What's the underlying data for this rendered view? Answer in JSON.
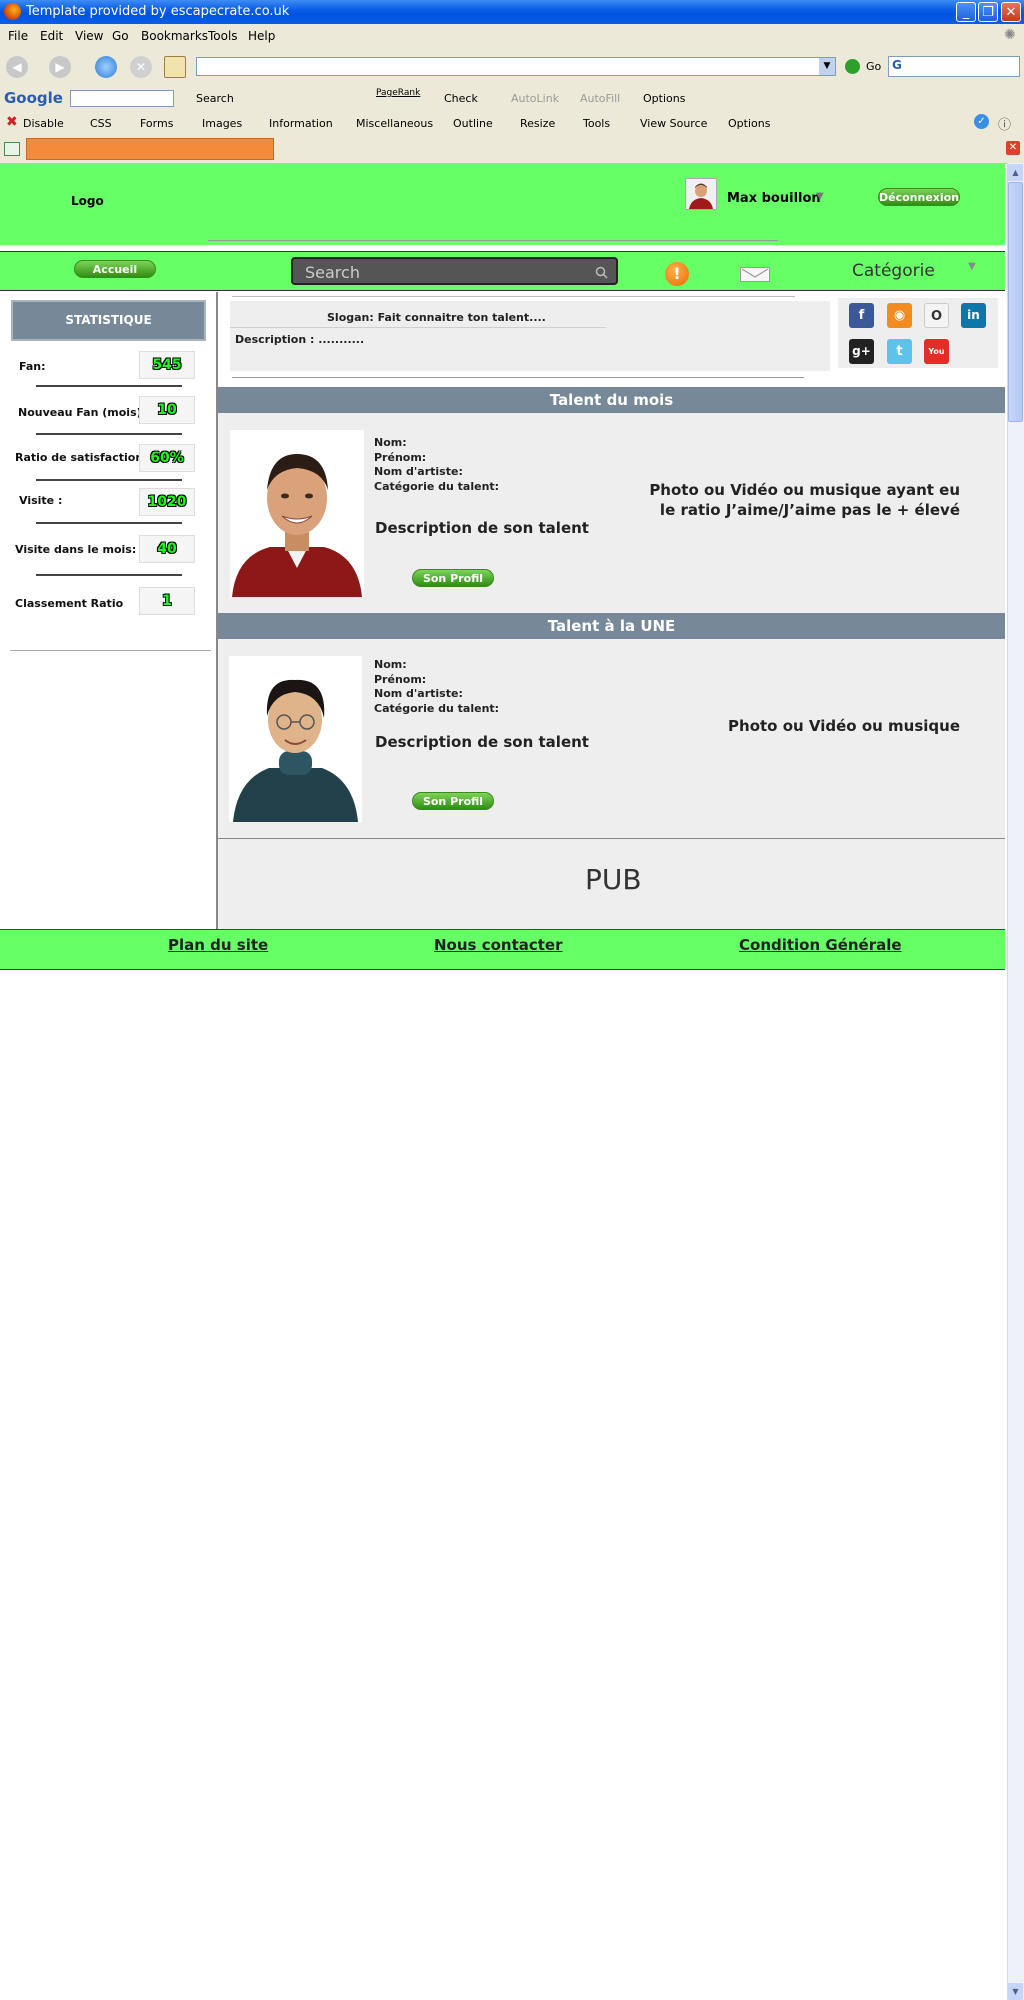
{
  "browser": {
    "title": "Template provided by escapecrate.co.uk",
    "menu": [
      "File",
      "Edit",
      "View",
      "Go",
      "Bookmarks",
      "Tools",
      "Help"
    ],
    "go_label": "Go",
    "google_toolbar": {
      "logo": "Google",
      "search": "Search",
      "pagerank": "PageRank",
      "check": "Check",
      "autolink": "AutoLink",
      "autofill": "AutoFill",
      "options": "Options"
    },
    "webdev_toolbar": [
      "Disable",
      "CSS",
      "Forms",
      "Images",
      "Information",
      "Miscellaneous",
      "Outline",
      "Resize",
      "Tools",
      "View Source",
      "Options"
    ]
  },
  "header": {
    "logo": "Logo",
    "user_name": "Max bouillon",
    "logout_label": "Déconnexion"
  },
  "nav": {
    "home_label": "Accueil",
    "search_placeholder": "Search",
    "category_label": "Catégorie"
  },
  "stats": {
    "title": "STATISTIQUE",
    "items": [
      {
        "label": "Fan:",
        "value": "545"
      },
      {
        "label": "Nouveau Fan (mois):",
        "value": "10"
      },
      {
        "label": "Ratio de satisfaction:",
        "value": "60%"
      },
      {
        "label": "Visite :",
        "value": "1020"
      },
      {
        "label": "Visite dans le mois:",
        "value": "40"
      },
      {
        "label": "Classement Ratio",
        "value": "1"
      }
    ]
  },
  "intro": {
    "slogan": "Slogan: Fait connaitre ton talent....",
    "description": "Description : ..........."
  },
  "social": [
    {
      "icon": "facebook-icon",
      "glyph": "f",
      "color": "#3b5998"
    },
    {
      "icon": "rss-icon",
      "glyph": "◉",
      "color": "#f28c20"
    },
    {
      "icon": "openid-icon",
      "glyph": "O",
      "color": "#f4f4f4"
    },
    {
      "icon": "linkedin-icon",
      "glyph": "in",
      "color": "#0e76a8"
    },
    {
      "icon": "google-plus-icon",
      "glyph": "g+",
      "color": "#222222"
    },
    {
      "icon": "twitter-icon",
      "glyph": "t",
      "color": "#5ec3ea"
    },
    {
      "icon": "youtube-icon",
      "glyph": "You",
      "color": "#e52d27"
    }
  ],
  "talent_month": {
    "heading": "Talent du mois",
    "fields": [
      "Nom:",
      "Prénom:",
      "Nom d'artiste:",
      "Catégorie du talent:"
    ],
    "description": "Description de son talent",
    "media_line1": "Photo ou Vidéo ou musique ayant eu",
    "media_line2": "le ratio J’aime/J’aime pas le + élevé",
    "button": "Son Profil"
  },
  "talent_une": {
    "heading": "Talent à la UNE",
    "fields": [
      "Nom:",
      "Prénom:",
      "Nom d'artiste:",
      "Catégorie du talent:"
    ],
    "description": "Description de son talent",
    "media": "Photo ou Vidéo ou musique",
    "button": "Son Profil"
  },
  "pub": "PUB",
  "footer": {
    "sitemap": "Plan du site",
    "contact": "Nous contacter",
    "terms": "Condition Générale"
  },
  "colors": {
    "brand_green": "#66ff66",
    "section_slate": "#778899",
    "panel_gray": "#eeeeee"
  }
}
